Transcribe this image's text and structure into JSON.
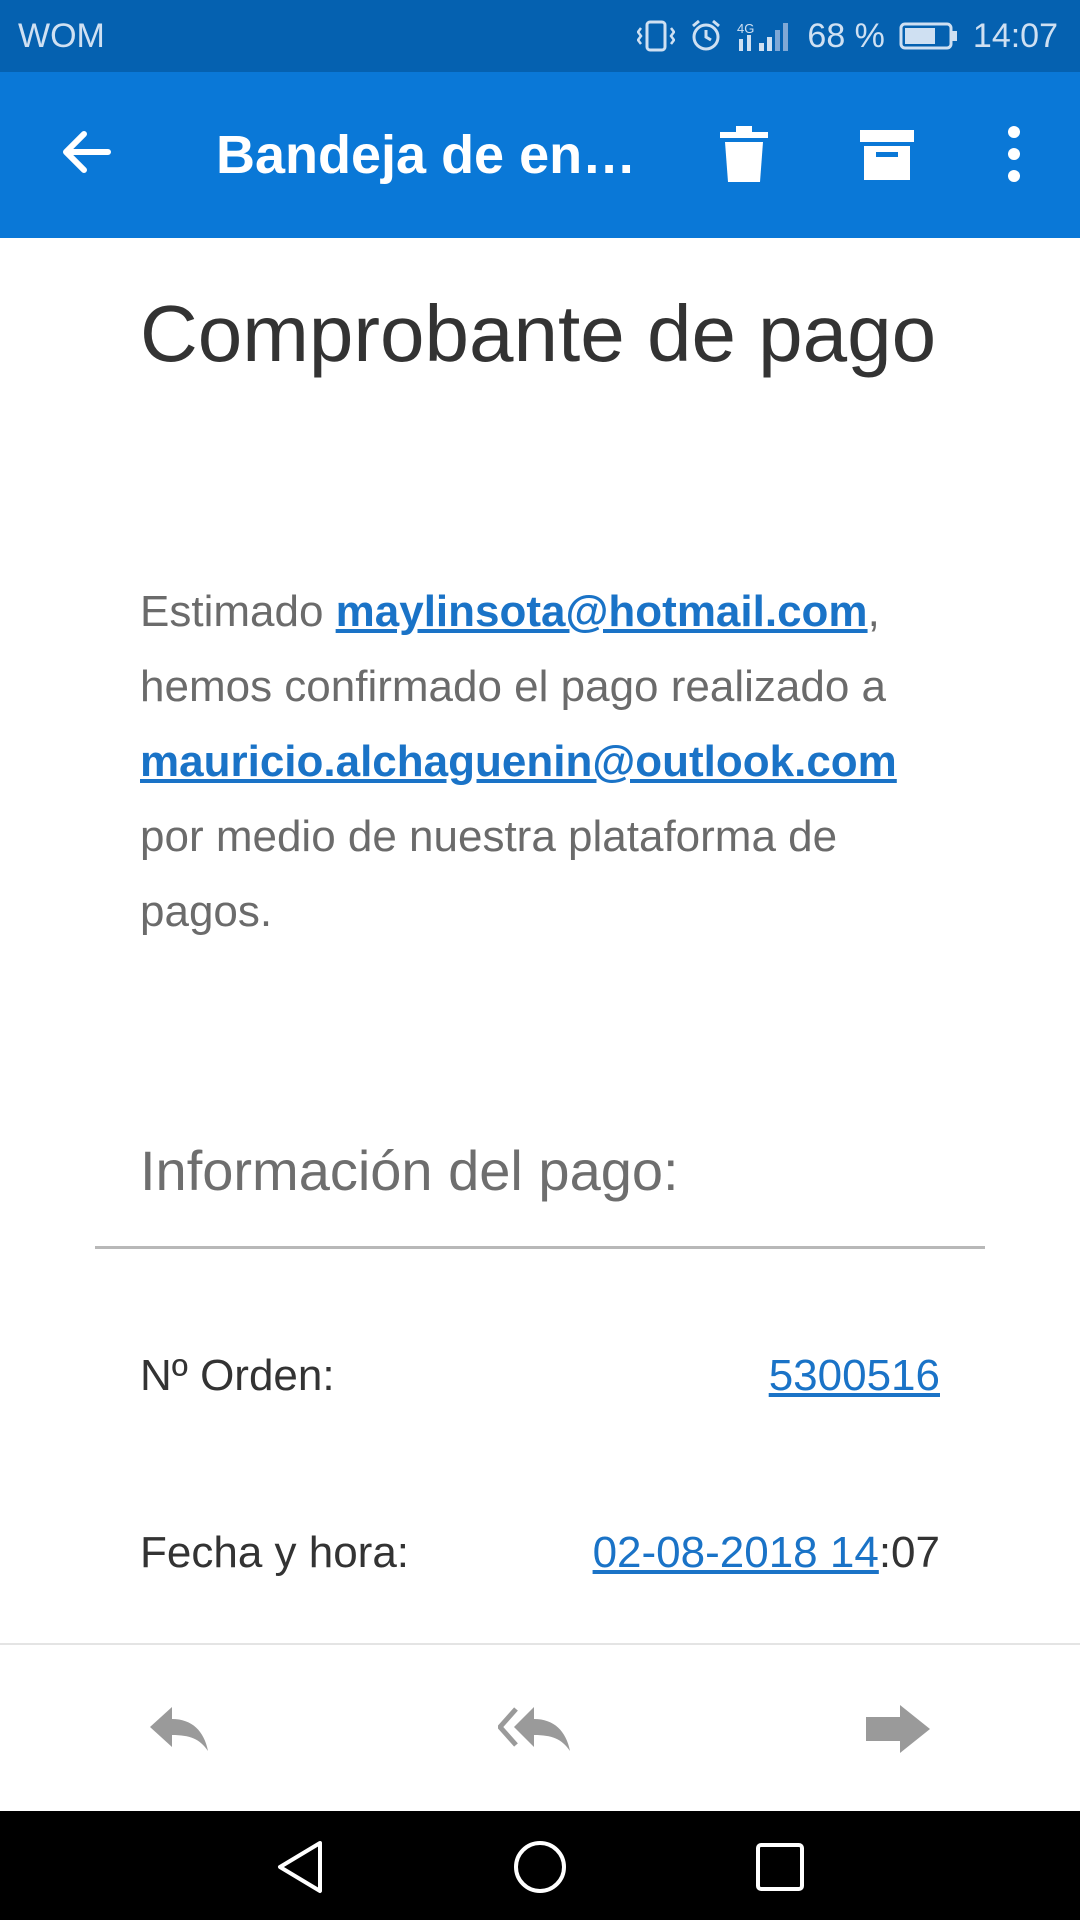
{
  "status_bar": {
    "carrier": "WOM",
    "network": "4G",
    "battery": "68 %",
    "time": "14:07"
  },
  "app_bar": {
    "title": "Bandeja de en…",
    "icons": [
      "back-arrow-icon",
      "trash-icon",
      "archive-icon",
      "more-vert-icon"
    ]
  },
  "email": {
    "subject": "Comprobante de pago",
    "body": {
      "greeting": "Estimado ",
      "sender_email": "maylinsota@hotmail.com",
      "comma": ",",
      "line2": " hemos confirmado el pago realizado a ",
      "recipient_email": "mauricio.alchaguenin@outlook.com",
      "line3": " por medio de nuestra plataforma de pagos."
    },
    "section_title": "Información del pago:",
    "order_label": "Nº Orden:",
    "order_value": "5300516",
    "date_label": "Fecha y hora:",
    "date_link": "02-08-2018 14",
    "date_rest": ":07"
  },
  "action_bar": {
    "icons": [
      "reply-icon",
      "reply-all-icon",
      "forward-icon"
    ]
  },
  "nav_bar": {
    "icons": [
      "back-triangle-icon",
      "home-circle-icon",
      "recents-square-icon"
    ]
  },
  "colors": {
    "status_bar": "#0561b0",
    "app_bar": "#0a78d7",
    "link": "#1a73c7"
  }
}
